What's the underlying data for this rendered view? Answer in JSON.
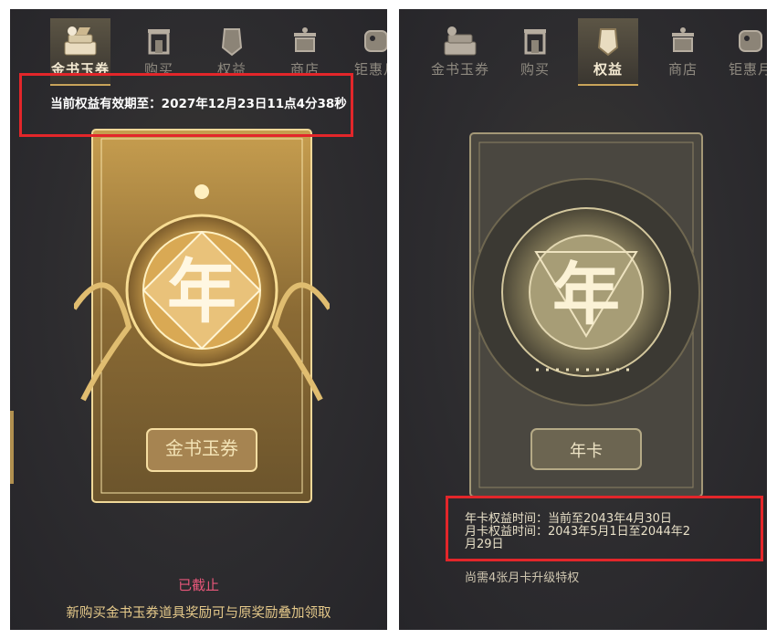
{
  "left_panel": {
    "tabs": [
      {
        "label": "金书玉券",
        "icon": "ticket-books-icon",
        "active": true
      },
      {
        "label": "购买",
        "icon": "shop-gate-icon",
        "active": false
      },
      {
        "label": "权益",
        "icon": "shield-badge-icon",
        "active": false
      },
      {
        "label": "商店",
        "icon": "store-basket-icon",
        "active": false
      },
      {
        "label": "钜惠月",
        "icon": "discount-tag-icon",
        "active": false
      }
    ],
    "expiry_text": "当前权益有效期至：2027年12月23日11点4分38秒",
    "card": {
      "emblem_char": "年",
      "plate_label": "金书玉券"
    },
    "status_text": "已截止",
    "notice_text": "新购买金书玉券道具奖励可与原奖励叠加领取"
  },
  "right_panel": {
    "tabs": [
      {
        "label": "金书玉券",
        "icon": "ticket-books-icon",
        "active": false
      },
      {
        "label": "购买",
        "icon": "shop-gate-icon",
        "active": false
      },
      {
        "label": "权益",
        "icon": "shield-badge-icon",
        "active": true
      },
      {
        "label": "商店",
        "icon": "store-basket-icon",
        "active": false
      },
      {
        "label": "钜惠月",
        "icon": "discount-tag-icon",
        "active": false
      }
    ],
    "card": {
      "emblem_char": "年",
      "plate_label": "年卡"
    },
    "rights_lines": [
      "年卡权益时间：当前至2043年4月30日",
      "月卡权益时间：2043年5月1日至2044年2",
      "月29日"
    ],
    "upgrade_text": "尚需4张月卡升级特权"
  },
  "colors": {
    "highlight_box": "#e3262a",
    "gold": "#d9b56a",
    "status_red": "#e8577a",
    "notice_gold": "#e5c98a"
  }
}
